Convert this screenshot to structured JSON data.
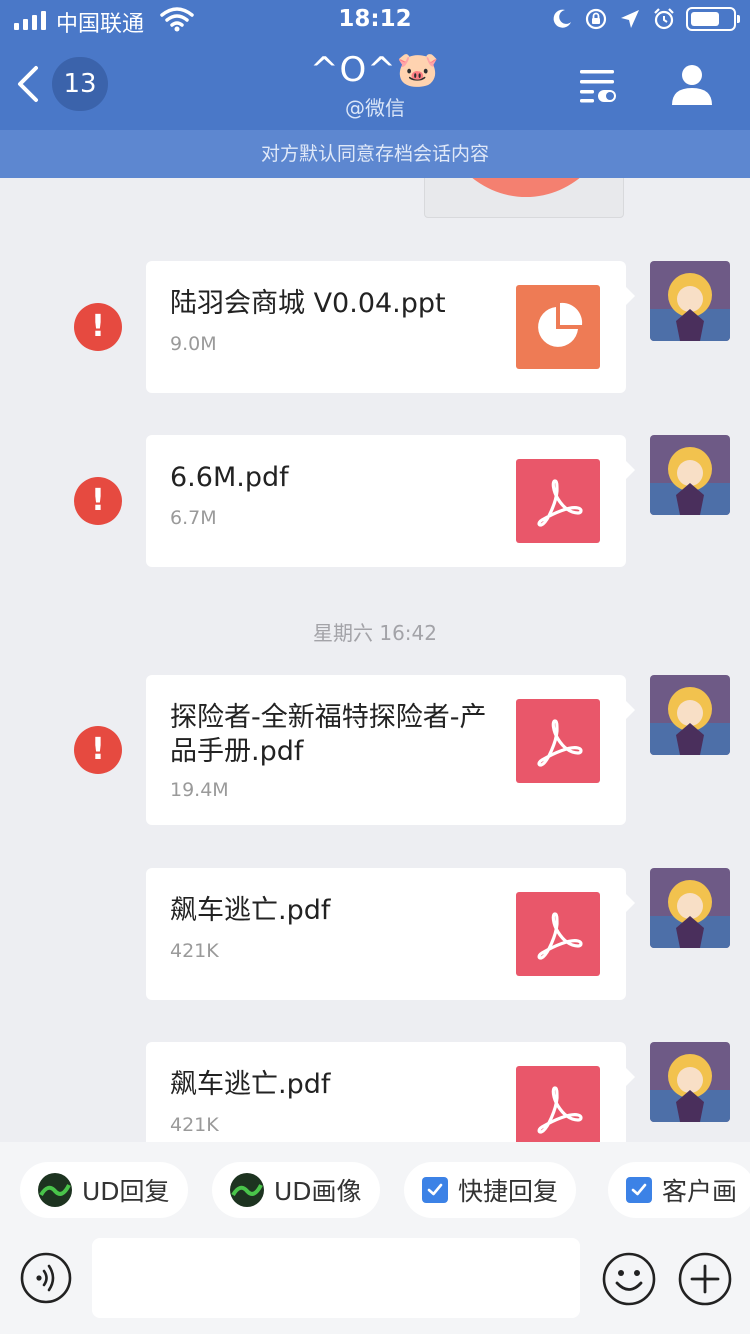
{
  "status_bar": {
    "carrier": "中国联通",
    "time": "18:12"
  },
  "nav": {
    "unread_count": "13",
    "title": "^O^🐷",
    "subtitle": "@微信"
  },
  "notice": "对方默认同意存档会话内容",
  "messages": [
    {
      "file_name": "陆羽会商城 V0.04.ppt",
      "file_size": "9.0M",
      "file_type": "ppt",
      "failed": true
    },
    {
      "file_name": "6.6M.pdf",
      "file_size": "6.7M",
      "file_type": "pdf",
      "failed": true
    },
    {
      "file_name": "探险者-全新福特探险者-产品手册.pdf",
      "file_size": "19.4M",
      "file_type": "pdf",
      "failed": true
    },
    {
      "file_name": "飙车逃亡.pdf",
      "file_size": "421K",
      "file_type": "pdf",
      "failed": false
    },
    {
      "file_name": "飙车逃亡.pdf",
      "file_size": "421K",
      "file_type": "pdf",
      "failed": false
    }
  ],
  "timestamp": "星期六 16:42",
  "quick_actions": [
    {
      "label": "UD回复",
      "icon": "ud-logo-icon"
    },
    {
      "label": "UD画像",
      "icon": "ud-logo-icon"
    },
    {
      "label": "快捷回复",
      "icon": "checkbox-icon"
    },
    {
      "label": "客户画",
      "icon": "checkbox-icon"
    }
  ],
  "colors": {
    "header_blue": "#4a78c8",
    "error_red": "#e64a40",
    "ppt_orange": "#ee7b55",
    "pdf_pink": "#e9576a"
  }
}
